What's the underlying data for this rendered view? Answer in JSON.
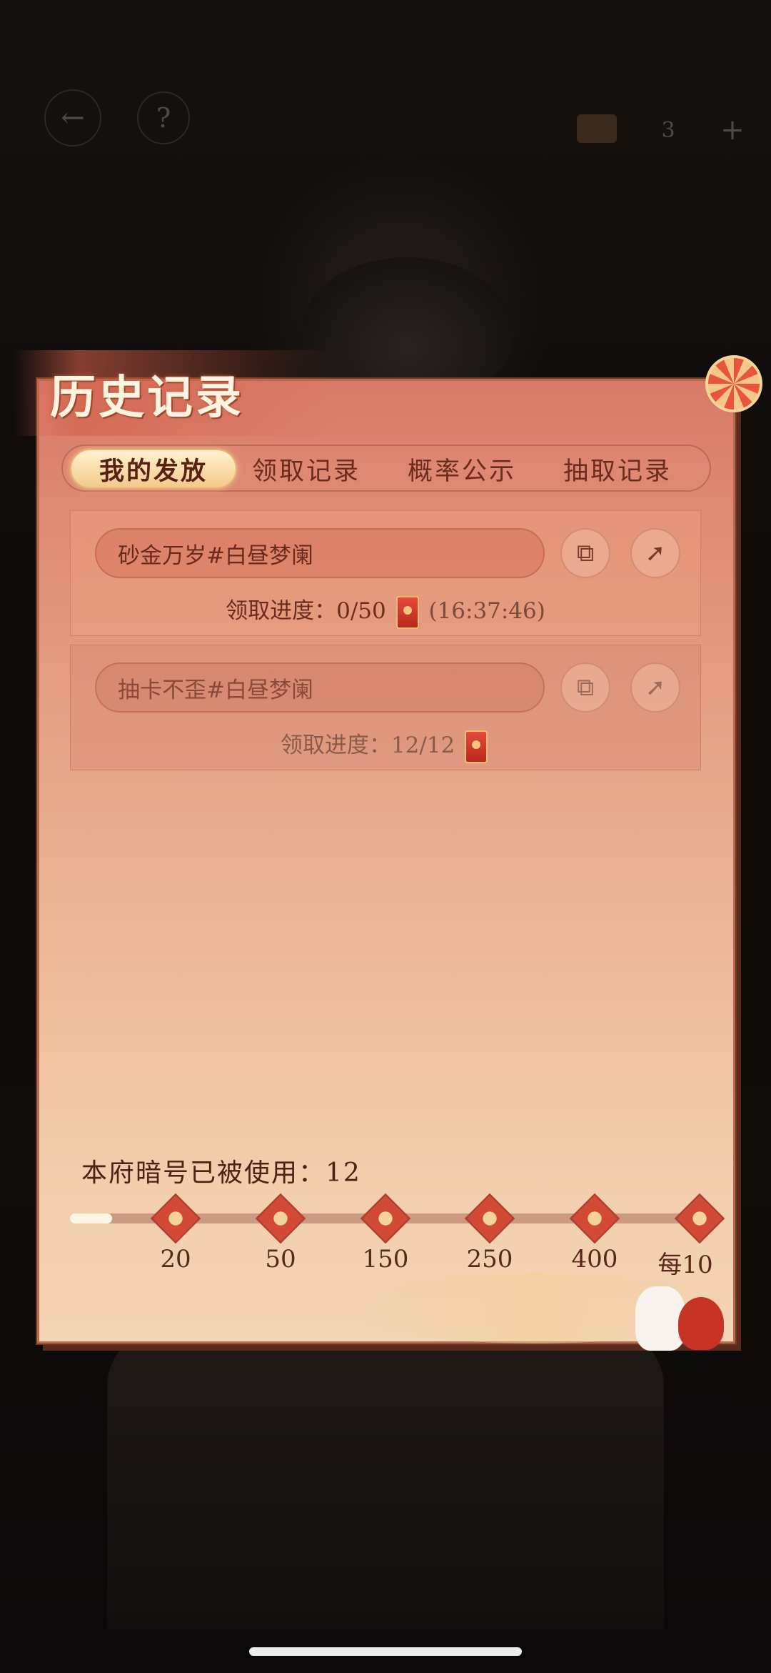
{
  "topbar": {
    "back_icon": "←",
    "help_icon": "?",
    "currency_count": "3",
    "add_icon": "+"
  },
  "panel": {
    "title": "历史记录"
  },
  "tabs": [
    {
      "label": "我的发放",
      "active": true
    },
    {
      "label": "领取记录",
      "active": false
    },
    {
      "label": "概率公示",
      "active": false
    },
    {
      "label": "抽取记录",
      "active": false
    }
  ],
  "items": [
    {
      "name": "砂金万岁#白昼梦阑",
      "progress_label": "领取进度：0/50",
      "timer": "(16:37:46)",
      "status": "active"
    },
    {
      "name": "抽卡不歪#白昼梦阑",
      "progress_label": "领取进度：12/12",
      "timer": "",
      "status": "done"
    }
  ],
  "usage": {
    "label": "本府暗号已被使用：12",
    "used": 12,
    "milestones": [
      "20",
      "50",
      "150",
      "250",
      "400",
      "每10"
    ]
  },
  "colors": {
    "accent": "#d24a35",
    "panel_top": "#d97a68",
    "panel_bottom": "#f3d4b4",
    "text_dark": "#6b2b1e"
  },
  "icons": {
    "copy": "copy-icon",
    "share": "share-icon",
    "redpacket": "red-packet-icon",
    "milestone": "red-envelope-milestone-icon"
  }
}
